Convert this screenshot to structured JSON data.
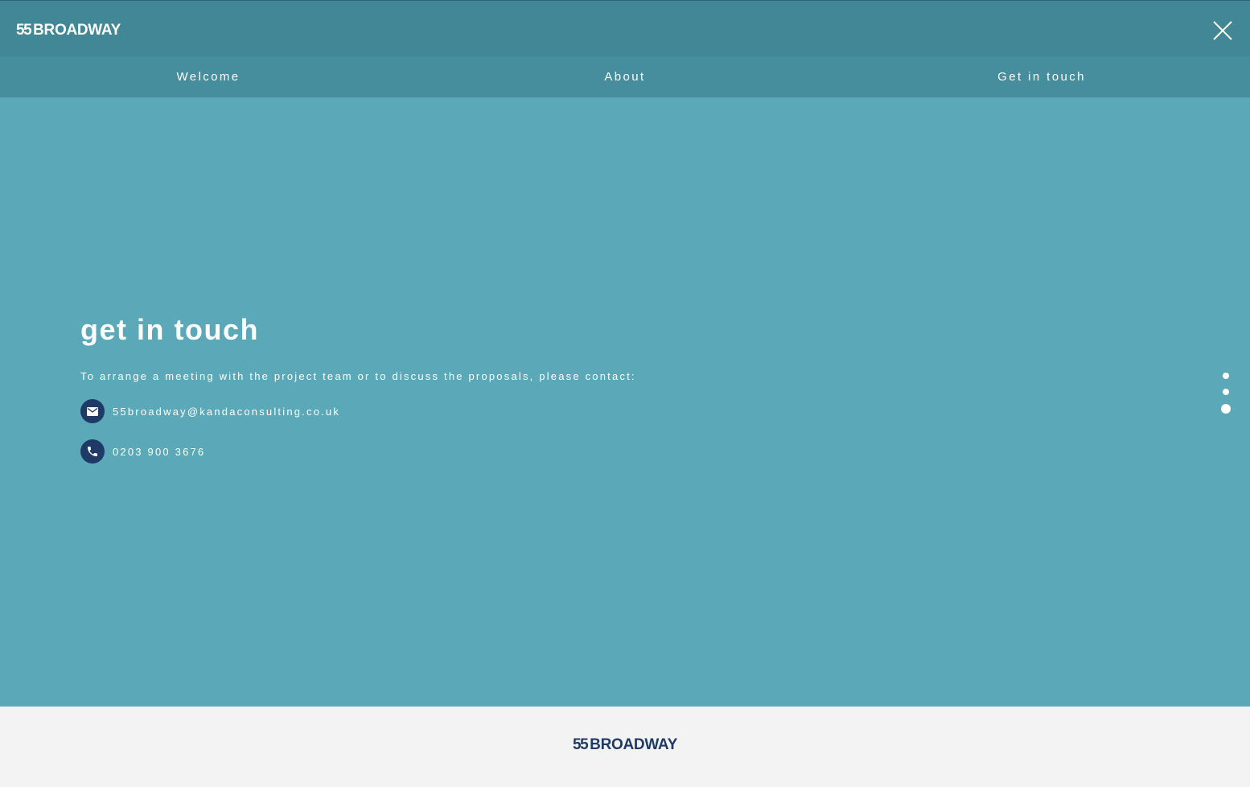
{
  "header": {
    "logo_number": "55",
    "logo_word": "BROADWAY",
    "close_icon": "close-icon"
  },
  "nav": {
    "items": [
      {
        "label": "Welcome"
      },
      {
        "label": "About"
      },
      {
        "label": "Get in touch"
      }
    ]
  },
  "main": {
    "heading": "get in touch",
    "intro": "To arrange a meeting with the project team or to discuss the proposals, please contact:",
    "email": {
      "icon": "envelope-icon",
      "value": "55broadway@kandaconsulting.co.uk"
    },
    "phone": {
      "icon": "phone-icon",
      "value": "0203 900 3676"
    }
  },
  "section_dots": {
    "count": 3,
    "active_index": 2
  },
  "footer": {
    "logo_number": "55",
    "logo_word": "BROADWAY"
  },
  "colors": {
    "header_bg": "#428796",
    "nav_bg": "#468d9e",
    "main_bg": "#5ba9b8",
    "navy": "#1f3a66",
    "footer_bg": "#f3f3f3"
  }
}
